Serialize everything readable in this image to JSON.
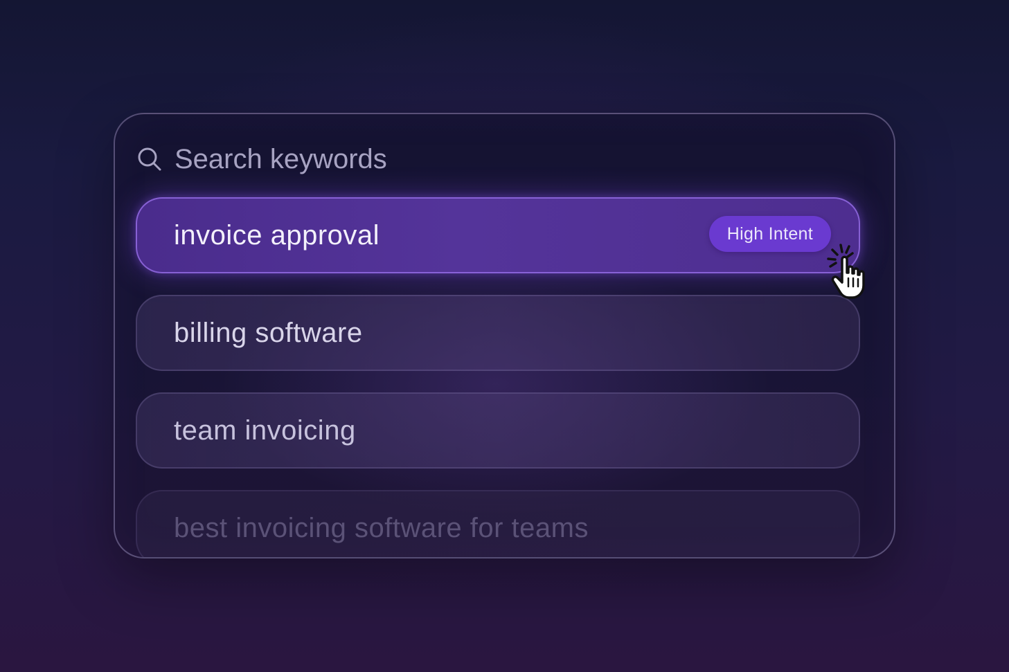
{
  "search": {
    "placeholder": "Search keywords",
    "icon": "search-icon"
  },
  "keywords": [
    {
      "label": "invoice approval",
      "state": "hovered",
      "badge": "High Intent"
    },
    {
      "label": "billing software",
      "state": "default"
    },
    {
      "label": "team invoicing",
      "state": "default"
    },
    {
      "label": "best invoicing software for teams",
      "state": "faded"
    }
  ],
  "cursor": {
    "icon": "pointer-hand-click-icon"
  },
  "colors": {
    "accent": "#6a3ad0",
    "active_row": "#54349a",
    "background": "#1a1a40"
  }
}
